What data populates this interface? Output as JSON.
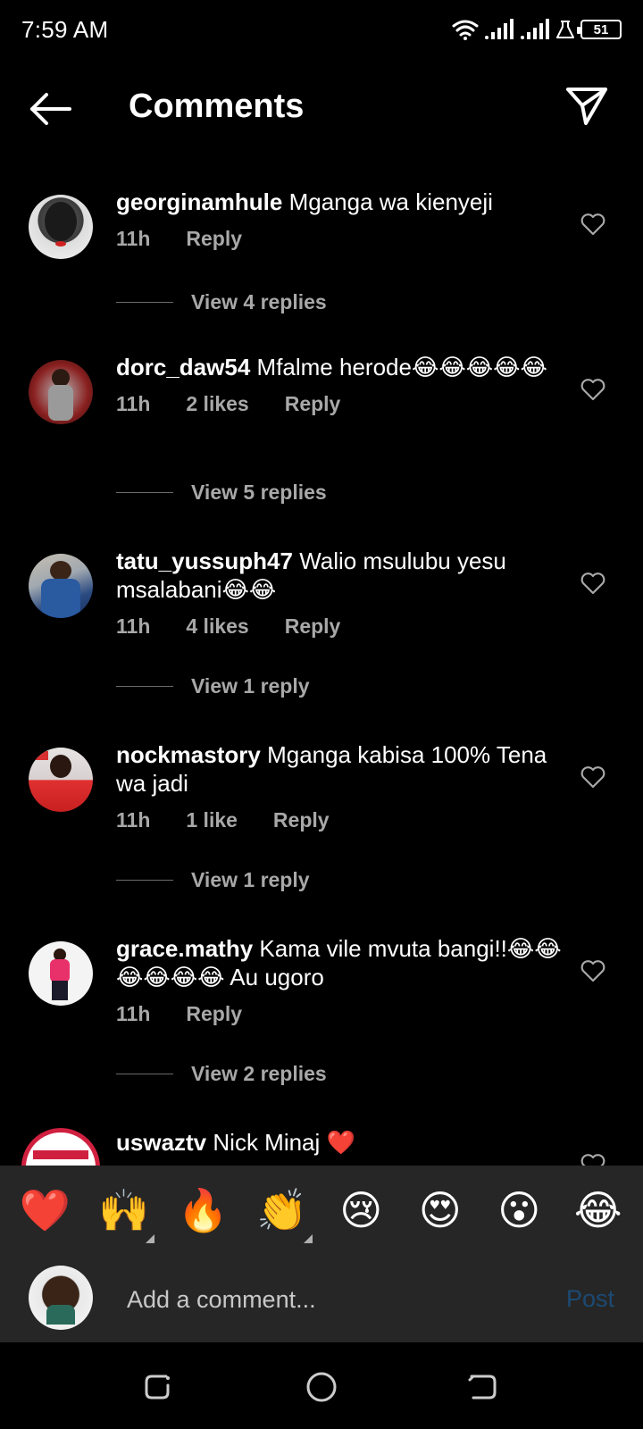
{
  "status_bar": {
    "time": "7:59 AM",
    "battery": "51"
  },
  "header": {
    "title": "Comments"
  },
  "comments": [
    {
      "user": "georginamhule",
      "text": "Mganga wa kienyeji",
      "time": "11h",
      "likes": "",
      "reply": "Reply",
      "view_replies": "View 4 replies"
    },
    {
      "user": "dorc_daw54",
      "text": "Mfalme herode😂😂😂😂😂",
      "time": "11h",
      "likes": "2 likes",
      "reply": "Reply",
      "view_replies": "View 5 replies"
    },
    {
      "user": "tatu_yussuph47",
      "text": "Walio msulubu yesu msalabani😂😂",
      "time": "11h",
      "likes": "4 likes",
      "reply": "Reply",
      "view_replies": "View 1 reply"
    },
    {
      "user": "nockmastory",
      "text": "Mganga kabisa 100% Tena wa jadi",
      "time": "11h",
      "likes": "1 like",
      "reply": "Reply",
      "view_replies": "View 1 reply"
    },
    {
      "user": "grace.mathy",
      "text": "Kama vile mvuta bangi!!😂😂😂😂😂😂 Au ugoro",
      "time": "11h",
      "likes": "",
      "reply": "Reply",
      "view_replies": "View 2 replies"
    },
    {
      "user": "uswaztv",
      "text": "Nick Minaj ❤️"
    }
  ],
  "emoji_bar": [
    "❤️",
    "🙌",
    "🔥",
    "👏",
    "😢",
    "😍",
    "😮",
    "😂"
  ],
  "composer": {
    "placeholder": "Add a comment...",
    "post_label": "Post"
  },
  "colors": {
    "background": "#000000",
    "panel": "#262626",
    "muted_text": "#a8a8a8",
    "post_disabled": "#1c4a73",
    "heart_outline": "#a8a8a8"
  }
}
